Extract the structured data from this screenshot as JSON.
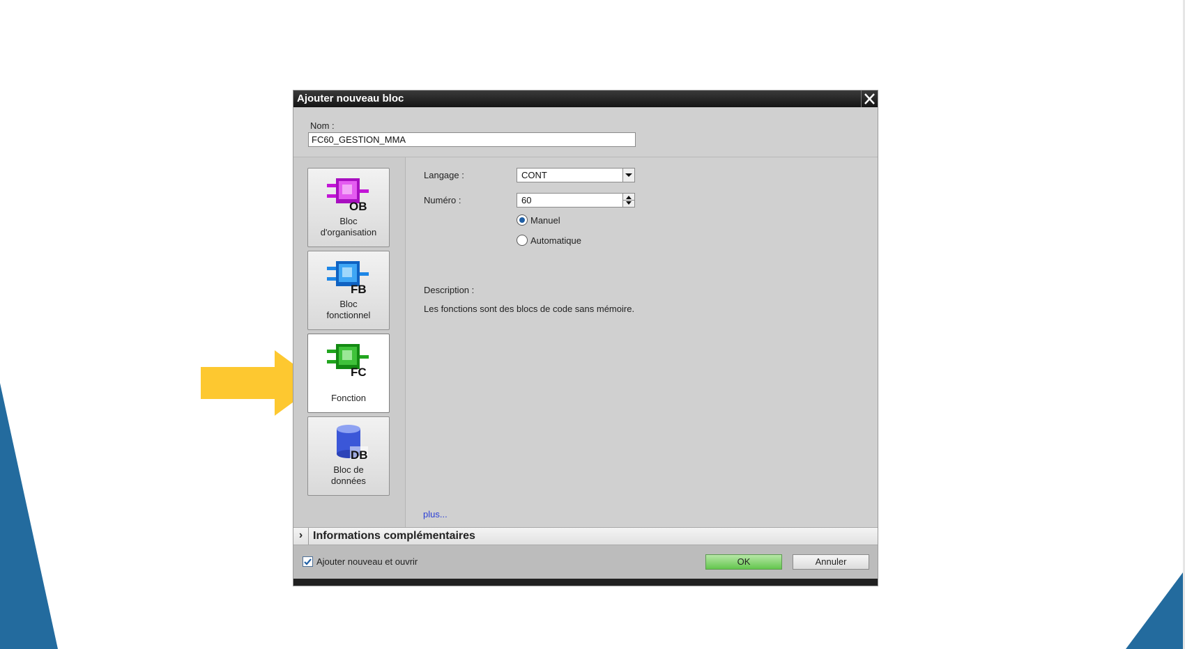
{
  "dialog": {
    "title": "Ajouter nouveau bloc",
    "close_icon": "close-icon"
  },
  "name_field": {
    "label": "Nom :",
    "value": "FC60_GESTION_MMA"
  },
  "block_types": [
    {
      "label": "Bloc\nd'organisation",
      "icon": "organization-block-icon",
      "badge": "OB",
      "color": "#c215d6",
      "selected": false
    },
    {
      "label": "Bloc\nfonctionnel",
      "icon": "function-block-icon",
      "badge": "FB",
      "color": "#1d86e6",
      "selected": false
    },
    {
      "label": "Fonction",
      "icon": "function-icon",
      "badge": "FC",
      "color": "#22a51f",
      "selected": true
    },
    {
      "label": "Bloc de\ndonnées",
      "icon": "data-block-icon",
      "badge": "DB",
      "color": "#3b57d8",
      "selected": false
    }
  ],
  "settings": {
    "language_label": "Langage :",
    "language_value": "CONT",
    "number_label": "Numéro :",
    "number_value": "60",
    "radio_manual": "Manuel",
    "radio_auto": "Automatique",
    "selected_mode": "Manuel"
  },
  "description": {
    "label": "Description :",
    "text": "Les fonctions sont des blocs de code sans mémoire."
  },
  "more_link": "plus...",
  "info_section": {
    "title": "Informations complémentaires"
  },
  "footer": {
    "checkbox_label": "Ajouter nouveau et ouvrir",
    "checkbox_checked": true,
    "ok_label": "OK",
    "cancel_label": "Annuler"
  },
  "colors": {
    "slide_accent": "#236b9e",
    "arrow": "#fdc830",
    "ok_button": "#64c64e"
  }
}
